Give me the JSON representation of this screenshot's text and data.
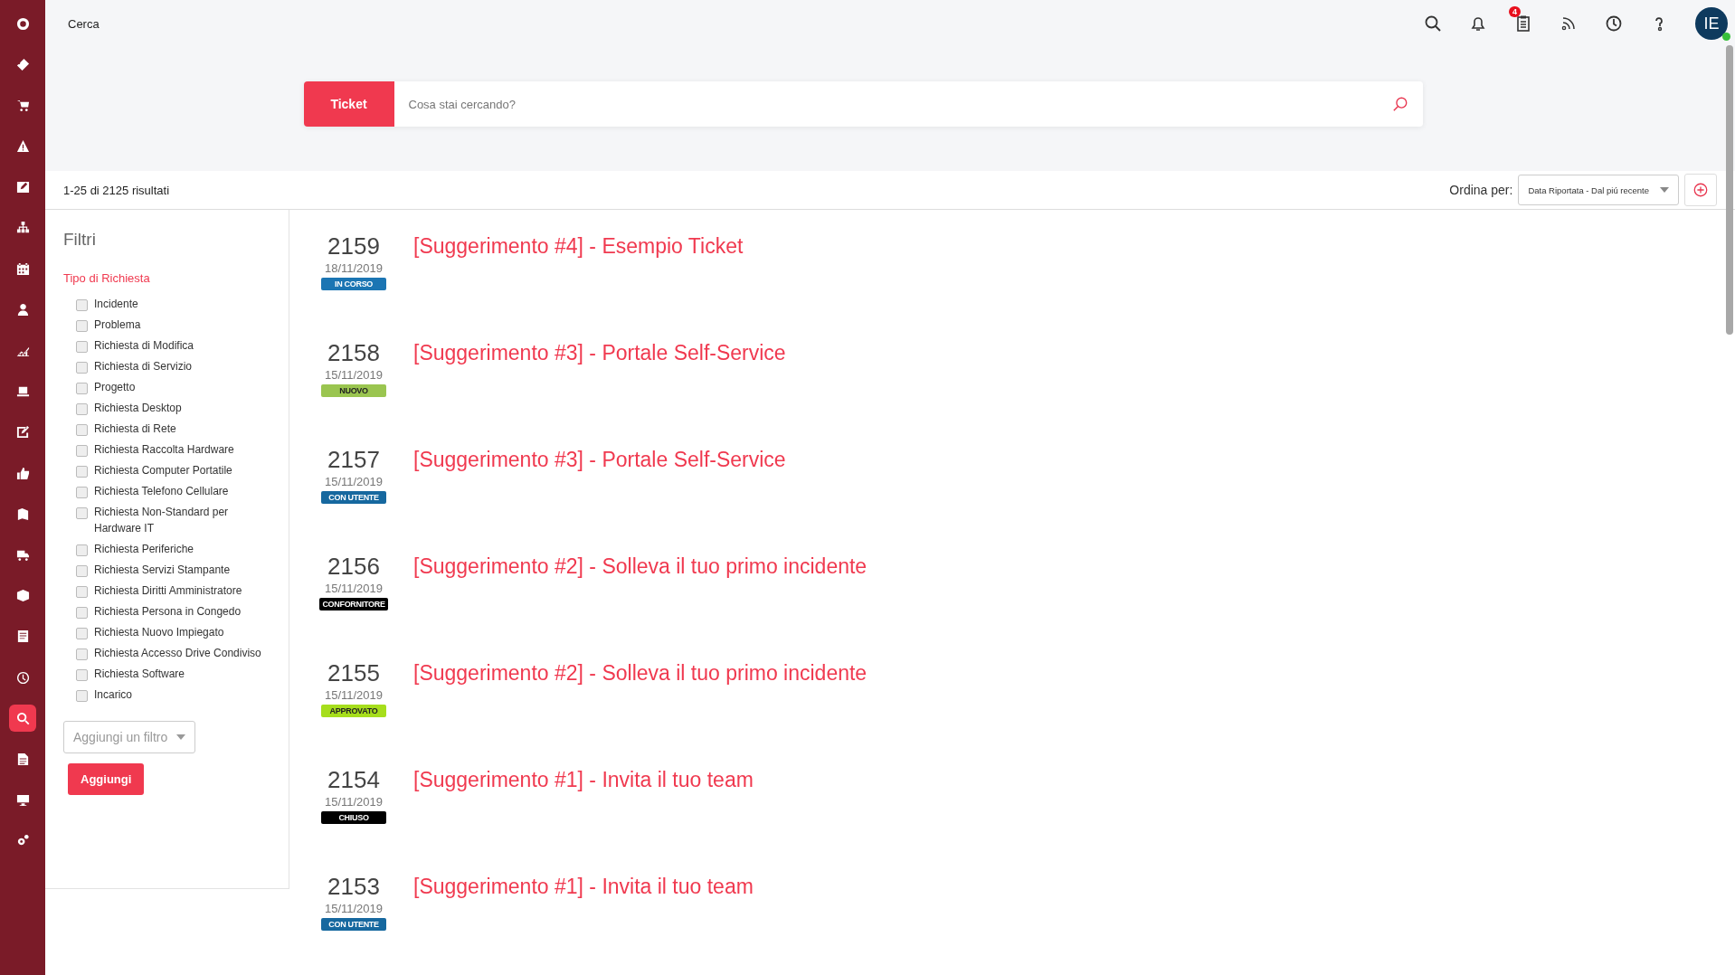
{
  "sidebar": {
    "items": [
      {
        "selected": false
      },
      {
        "selected": false
      },
      {
        "selected": false
      },
      {
        "selected": false
      },
      {
        "selected": false
      },
      {
        "selected": false
      },
      {
        "selected": false
      },
      {
        "selected": false
      },
      {
        "selected": false
      },
      {
        "selected": false
      },
      {
        "selected": false
      },
      {
        "selected": false
      },
      {
        "selected": false
      },
      {
        "selected": false
      },
      {
        "selected": false
      },
      {
        "selected": false
      },
      {
        "selected": false
      },
      {
        "selected": true
      },
      {
        "selected": false
      },
      {
        "selected": false
      },
      {
        "selected": false
      }
    ]
  },
  "topbar": {
    "title": "Cerca",
    "notification_count": "4",
    "avatar": {
      "initials": "IE",
      "online": true
    }
  },
  "search": {
    "scope": "Ticket",
    "placeholder": "Cosa stai cercando?"
  },
  "results_bar": {
    "count": "1-25 di 2125 risultati",
    "sort_label": "Ordina per:",
    "sort_value": "Data Riportata - Dal piú recente"
  },
  "filters": {
    "title": "Filtri",
    "group": "Tipo di Richiesta",
    "options": [
      {
        "label": "Incidente",
        "checked": false
      },
      {
        "label": "Problema",
        "checked": false
      },
      {
        "label": "Richiesta di Modifica",
        "checked": false
      },
      {
        "label": "Richiesta di Servizio",
        "checked": false
      },
      {
        "label": "Progetto",
        "checked": false
      },
      {
        "label": "Richiesta Desktop",
        "checked": false
      },
      {
        "label": "Richiesta di Rete",
        "checked": false
      },
      {
        "label": "Richiesta Raccolta Hardware",
        "checked": false
      },
      {
        "label": "Richiesta Computer Portatile",
        "checked": false
      },
      {
        "label": "Richiesta Telefono Cellulare",
        "checked": false
      },
      {
        "label": "Richiesta Non-Standard per Hardware IT",
        "checked": false
      },
      {
        "label": "Richiesta Periferiche",
        "checked": false
      },
      {
        "label": "Richiesta Servizi Stampante",
        "checked": false
      },
      {
        "label": "Richiesta Diritti Amministratore",
        "checked": false
      },
      {
        "label": "Richiesta Persona in Congedo",
        "checked": false
      },
      {
        "label": "Richiesta Nuovo Impiegato",
        "checked": false
      },
      {
        "label": "Richiesta Accesso Drive Condiviso",
        "checked": false
      },
      {
        "label": "Richiesta Software",
        "checked": false
      },
      {
        "label": "Incarico",
        "checked": false
      }
    ],
    "add_filter_placeholder": "Aggiungi un filtro",
    "add_button": "Aggiungi"
  },
  "results": [
    {
      "number": "2159",
      "date": "18/11/2019",
      "status": "IN CORSO",
      "color": "#1b75b3",
      "title": "[Suggerimento #4] - Esempio Ticket"
    },
    {
      "number": "2158",
      "date": "15/11/2019",
      "status": "NUOVO",
      "color": "#9ac550",
      "title": "[Suggerimento #3] - Portale Self-Service"
    },
    {
      "number": "2157",
      "date": "15/11/2019",
      "status": "CON UTENTE",
      "color": "#16689f",
      "title": "[Suggerimento #3] - Portale Self-Service"
    },
    {
      "number": "2156",
      "date": "15/11/2019",
      "status": "CONFORNITORE",
      "color": "#000000",
      "title": "[Suggerimento #2] - Solleva il tuo primo incidente"
    },
    {
      "number": "2155",
      "date": "15/11/2019",
      "status": "APPROVATO",
      "color": "#a6de1c",
      "title": "[Suggerimento #2] - Solleva il tuo primo incidente"
    },
    {
      "number": "2154",
      "date": "15/11/2019",
      "status": "CHIUSO",
      "color": "#000000",
      "title": "[Suggerimento #1] - Invita il tuo team"
    },
    {
      "number": "2153",
      "date": "15/11/2019",
      "status": "CON UTENTE",
      "color": "#16689f",
      "title": "[Suggerimento #1] - Invita il tuo team"
    }
  ]
}
